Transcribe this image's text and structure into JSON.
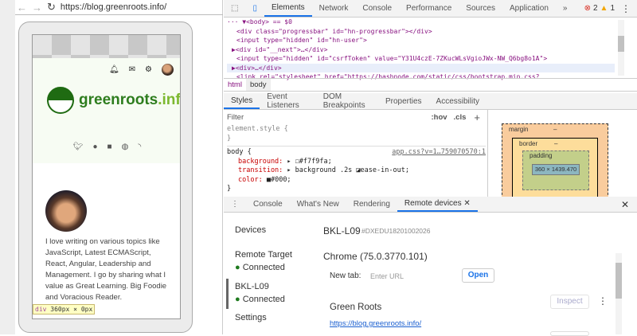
{
  "browser": {
    "url": "https://blog.greenroots.info/"
  },
  "site": {
    "logo_main": "greenroots",
    "logo_ext": ".info",
    "bio": "I love writing on various topics like JavaScript, Latest ECMAScript, React, Angular, Leadership and Management. I go by sharing what I value as Great Learning. Big Foodie and Voracious Reader.",
    "tooltip_tag": "div",
    "tooltip_size": "360px × 0px"
  },
  "devtools": {
    "tabs": [
      "Elements",
      "Network",
      "Console",
      "Performance",
      "Sources",
      "Application"
    ],
    "more": "»",
    "errors": "2",
    "warnings": "1",
    "dom": {
      "body_line": "··· ▼<body> == $0",
      "l1": "<div class=\"progressbar\" id=\"hn-progressbar\"></div>",
      "l2": "<input type=\"hidden\" id=\"hn-user\">",
      "l3": "▶<div id=\"__next\">…</div>",
      "l4": "<input type=\"hidden\" id=\"csrfToken\" value=\"Y31U4czE-7ZKucWLsVgioJWx-NW_Q6bg8o1A\">",
      "l5": "▶<div>…</div>",
      "l6": "<link rel=\"stylesheet\" href=\"https://hashnode.com/static/css/bootstrap.min.css?"
    },
    "breadcrumb": [
      "html",
      "body"
    ],
    "style_tabs": [
      "Styles",
      "Event Listeners",
      "DOM Breakpoints",
      "Properties",
      "Accessibility"
    ],
    "filter_placeholder": "Filter",
    "hov": ":hov",
    "cls": ".cls",
    "plus": "+",
    "styles": {
      "element_style": "element.style {",
      "close": "}",
      "selector": "body {",
      "source": "app.css?v=1…759070570:1",
      "p1_name": "background:",
      "p1_val": "▸ ☐#f7f9fa;",
      "p2_name": "transition:",
      "p2_val": "▸ background .2s ◪ease-in-out;",
      "p3_name": "color:",
      "p3_val": "■#000;"
    },
    "box": {
      "margin": "margin",
      "border": "border",
      "padding": "padding",
      "content": "360 × 1439.470",
      "dash": "–"
    },
    "drawer_tabs": [
      "Console",
      "What's New",
      "Rendering",
      "Remote devices"
    ],
    "remote": {
      "sidebar": [
        "Devices",
        "Remote Target",
        "Connected",
        "BKL-L09",
        "Connected",
        "Settings"
      ],
      "device": "BKL-L09",
      "serial": "#DXEDU18201002026",
      "browser": "Chrome (75.0.3770.101)",
      "newtab_label": "New tab:",
      "newtab_placeholder": "Enter URL",
      "open": "Open",
      "page_title": "Green Roots",
      "page_url": "https://blog.greenroots.info/",
      "inspect": "Inspect"
    }
  }
}
